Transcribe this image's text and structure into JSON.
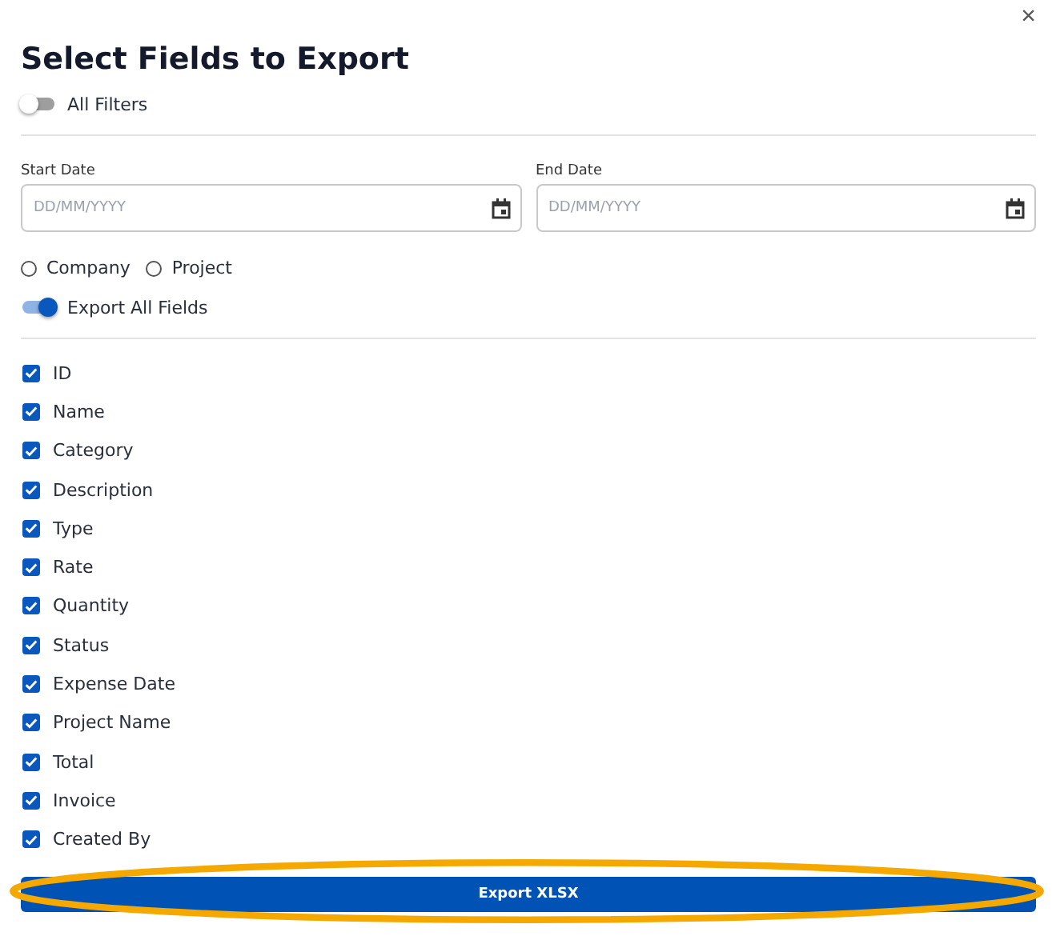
{
  "dialog": {
    "title": "Select Fields to Export",
    "close": "×"
  },
  "all_filters": {
    "label": "All Filters",
    "on": false
  },
  "dates": [
    {
      "label": "Start Date",
      "placeholder": "DD/MM/YYYY"
    },
    {
      "label": "End Date",
      "placeholder": "DD/MM/YYYY"
    }
  ],
  "scope": [
    {
      "label": "Company",
      "selected": false
    },
    {
      "label": "Project",
      "selected": false
    }
  ],
  "export_all": {
    "label": "Export All Fields",
    "on": true
  },
  "fields": [
    {
      "label": "ID",
      "checked": true
    },
    {
      "label": "Name",
      "checked": true
    },
    {
      "label": "Category",
      "checked": true
    },
    {
      "label": "Description",
      "checked": true
    },
    {
      "label": "Type",
      "checked": true
    },
    {
      "label": "Rate",
      "checked": true
    },
    {
      "label": "Quantity",
      "checked": true
    },
    {
      "label": "Status",
      "checked": true
    },
    {
      "label": "Expense Date",
      "checked": true
    },
    {
      "label": "Project Name",
      "checked": true
    },
    {
      "label": "Total",
      "checked": true
    },
    {
      "label": "Invoice",
      "checked": true
    },
    {
      "label": "Created By",
      "checked": true
    }
  ],
  "export_button": {
    "label": "Export XLSX",
    "highlighted": true
  }
}
